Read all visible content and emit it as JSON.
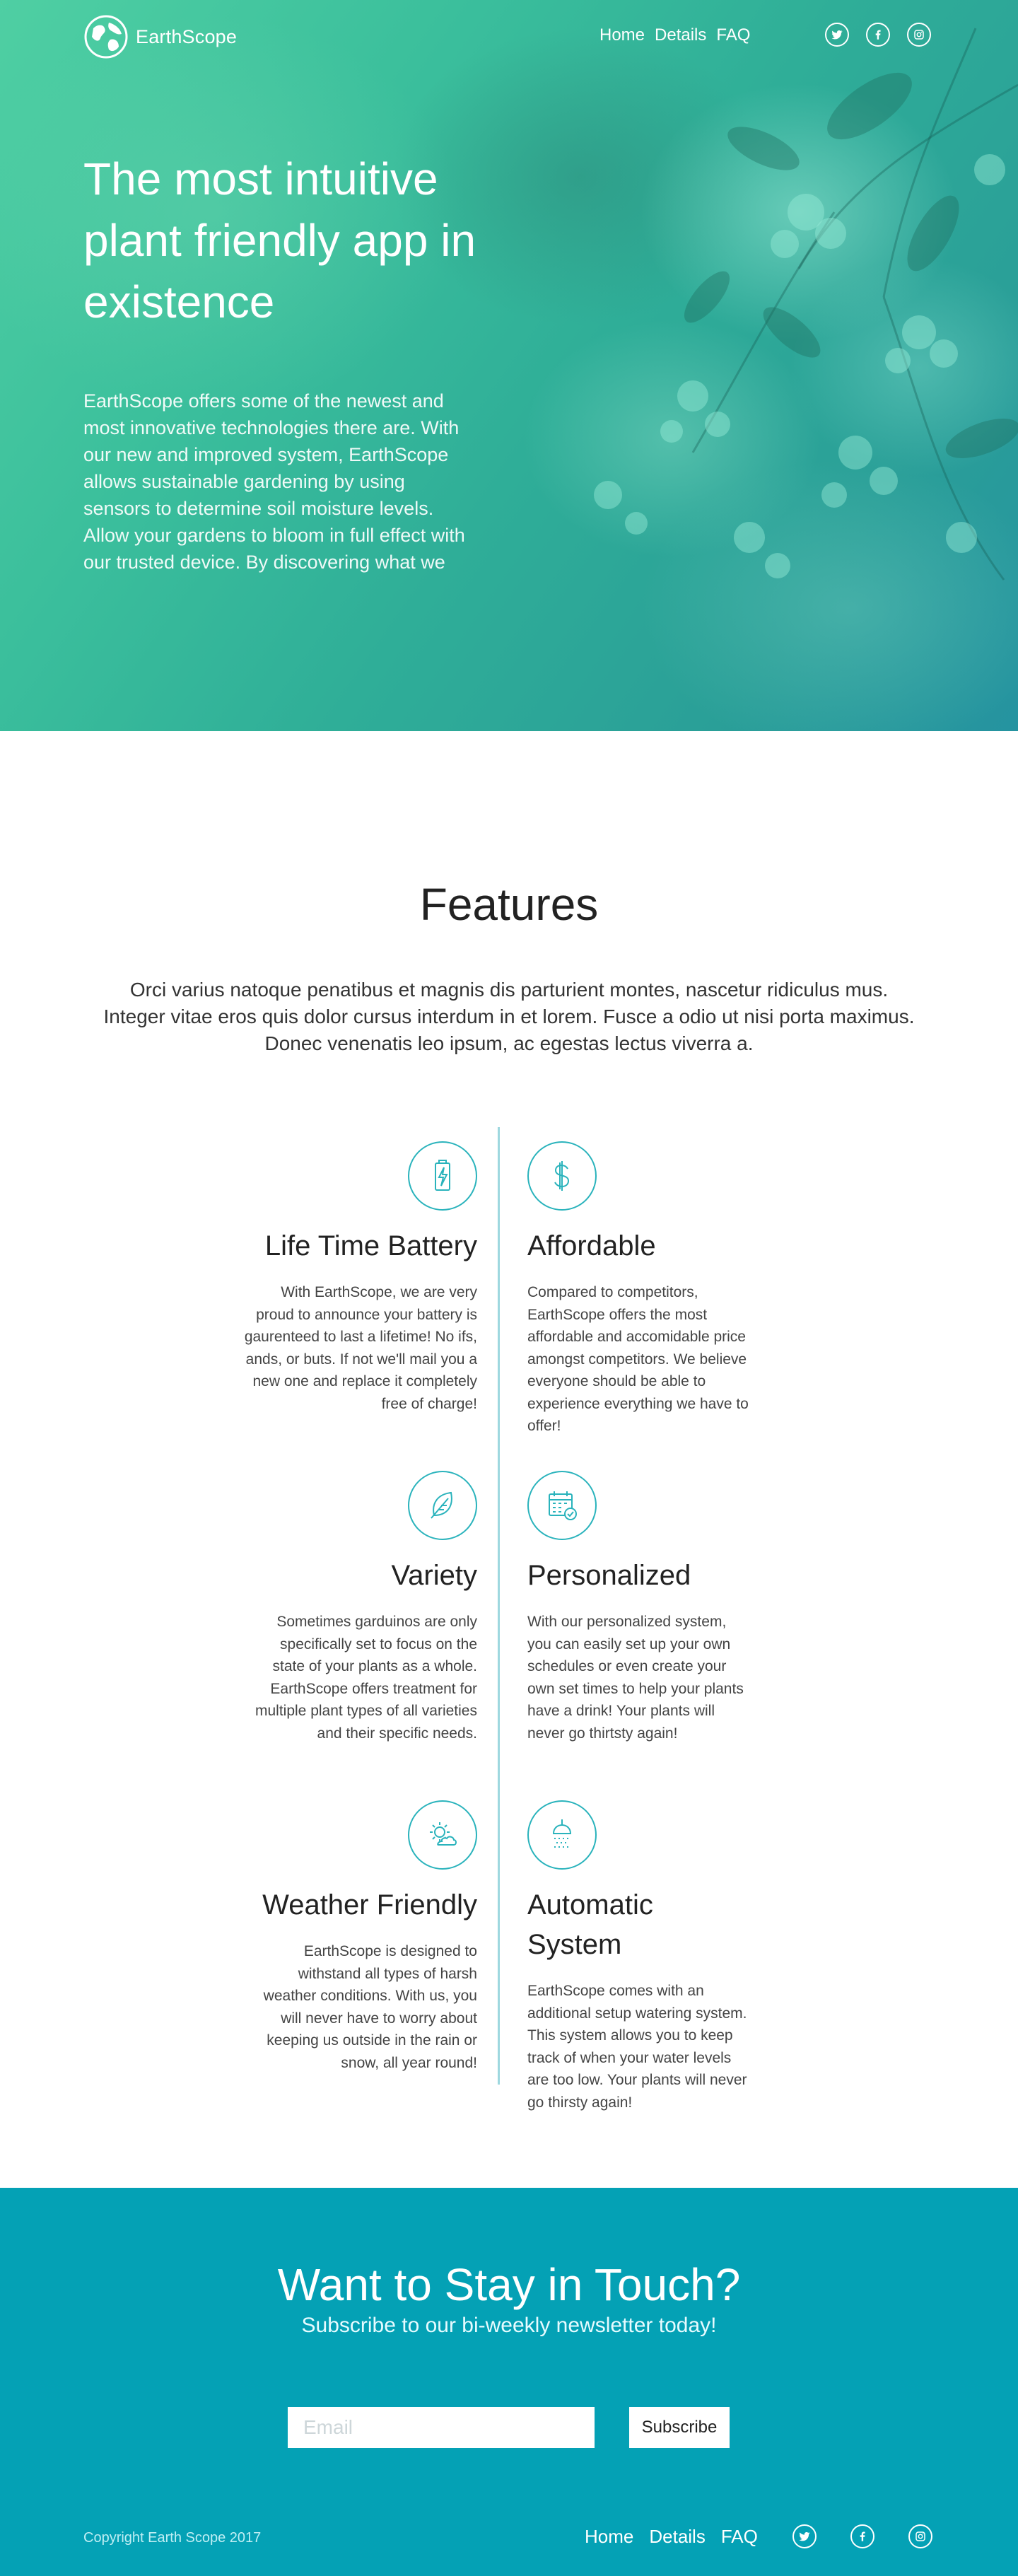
{
  "brand": {
    "name": "EarthScope"
  },
  "nav": {
    "links": [
      "Home",
      "Details",
      "FAQ"
    ]
  },
  "social": [
    "twitter-icon",
    "facebook-icon",
    "instagram-icon"
  ],
  "hero": {
    "title": "The most intuitive plant friendly app in existence",
    "description": "EarthScope offers some of the newest and most innovative technologies there are. With our new and improved system, EarthScope allows sustainable gardening by using sensors to determine soil moisture levels. Allow your gardens to bloom in full effect with our trusted device. By discovering what we"
  },
  "features": {
    "title": "Features",
    "intro": "Orci varius natoque penatibus et magnis dis parturient montes, nascetur ridiculus mus. Integer vitae eros quis dolor cursus interdum in et lorem. Fusce a odio ut nisi porta maximus. Donec venenatis leo ipsum, ac egestas lectus viverra a.",
    "items": [
      {
        "icon": "battery-icon",
        "title": "Life Time Battery",
        "text": "With EarthScope, we are very proud to announce your battery is gaurenteed to last a lifetime! No ifs, ands, or buts. If not we'll mail you a new one and replace it completely free of charge!"
      },
      {
        "icon": "dollar-icon",
        "title": "Affordable",
        "text": "Compared to competitors, EarthScope offers the most affordable and accomidable price amongst competitors. We believe everyone should be able to experience everything we have to offer!"
      },
      {
        "icon": "leaf-icon",
        "title": "Variety",
        "text": "Sometimes garduinos are only specifically set to focus on the state of your plants as a whole. EarthScope offers treatment for multiple plant types of all varieties and their specific needs."
      },
      {
        "icon": "calendar-check-icon",
        "title": "Personalized",
        "text": "With our personalized system, you can easily set up your own schedules or even create your own set times to help your plants have a drink! Your plants will never go thirtsty again!"
      },
      {
        "icon": "sun-cloud-icon",
        "title": "Weather Friendly",
        "text": "EarthScope is designed to withstand all types of harsh weather conditions. With us, you will never have to worry about keeping us outside in the rain or snow, all year round!"
      },
      {
        "icon": "shower-icon",
        "title": "Automatic System",
        "text": "EarthScope comes with an additional setup watering system. This system allows you to keep track of when your water levels are too low. Your plants will never go thirsty again!"
      }
    ]
  },
  "newsletter": {
    "title": "Want to Stay in Touch?",
    "subtitle": "Subscribe to our bi-weekly newsletter today!",
    "email_placeholder": "Email",
    "button_label": "Subscribe"
  },
  "footer": {
    "copyright": "Copyright Earth Scope 2017",
    "links": [
      "Home",
      "Details",
      "FAQ"
    ]
  },
  "colors": {
    "teal": "#04a1b5",
    "icon_stroke": "#2ab3bc",
    "divider": "#9ed8df"
  }
}
